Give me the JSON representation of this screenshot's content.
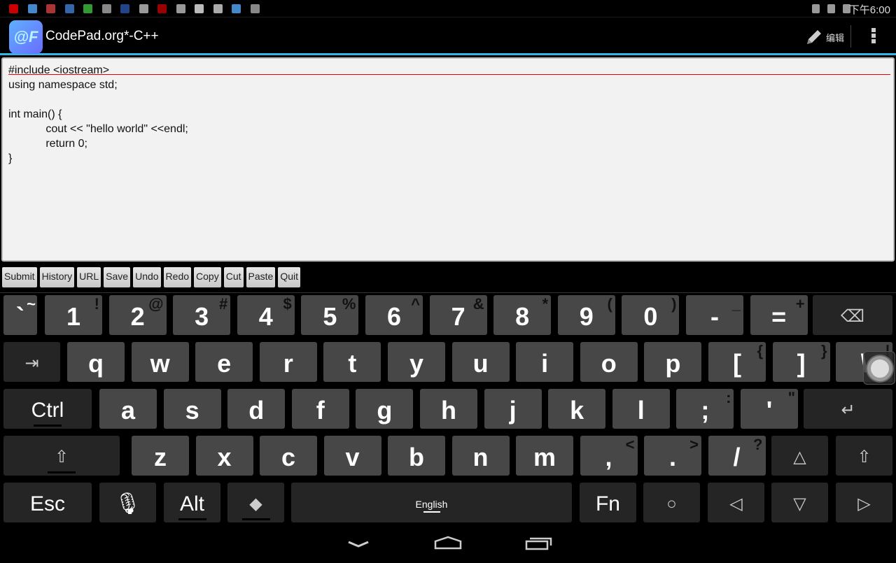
{
  "status_bar": {
    "time": "下午6:00",
    "notification_icons": [
      "play-icon",
      "butterfly-icon",
      "calendar-icon",
      "bird-icon",
      "network-icon",
      "circle-icon",
      "app-icon",
      "shield-icon",
      "badge-19-icon",
      "shield-icon",
      "keyboard-icon",
      "usb-icon",
      "butterfly-icon",
      "barcode-icon"
    ],
    "badge_number": "19",
    "system_icons": [
      "bluetooth-icon",
      "wifi-icon",
      "battery-charging-icon"
    ]
  },
  "action_bar": {
    "title": "CodePad.org*-C++",
    "logo_text": "@F",
    "edit_label": "编辑"
  },
  "editor": {
    "lines": [
      "#include <iostream>",
      "using namespace std;",
      "",
      "int main() {",
      "            cout << \"hello world\" <<endl;",
      "            return 0;",
      "}"
    ]
  },
  "toolbar": [
    "Submit",
    "History",
    "URL",
    "Save",
    "Undo",
    "Redo",
    "Copy",
    "Cut",
    "Paste",
    "Quit"
  ],
  "keyboard": {
    "rows": [
      [
        {
          "m": "`",
          "a": "~",
          "t": "l"
        },
        {
          "m": "1",
          "a": "!"
        },
        {
          "m": "2",
          "a": "@"
        },
        {
          "m": "3",
          "a": "#"
        },
        {
          "m": "4",
          "a": "$"
        },
        {
          "m": "5",
          "a": "%"
        },
        {
          "m": "6",
          "a": "^"
        },
        {
          "m": "7",
          "a": "&"
        },
        {
          "m": "8",
          "a": "*"
        },
        {
          "m": "9",
          "a": "("
        },
        {
          "m": "0",
          "a": ")"
        },
        {
          "m": "-",
          "a": "_"
        },
        {
          "m": "=",
          "a": "+"
        },
        {
          "m": "⌫",
          "t": "f",
          "n": "backspace"
        }
      ],
      [
        {
          "m": "⇥",
          "t": "f",
          "n": "tab"
        },
        {
          "m": "q"
        },
        {
          "m": "w"
        },
        {
          "m": "e"
        },
        {
          "m": "r"
        },
        {
          "m": "t"
        },
        {
          "m": "y"
        },
        {
          "m": "u"
        },
        {
          "m": "i"
        },
        {
          "m": "o"
        },
        {
          "m": "p"
        },
        {
          "m": "[",
          "a": "{"
        },
        {
          "m": "]",
          "a": "}"
        },
        {
          "m": "\\",
          "a": "|"
        }
      ],
      [
        {
          "m": "Ctrl",
          "t": "f",
          "u": true
        },
        {
          "m": "a"
        },
        {
          "m": "s"
        },
        {
          "m": "d"
        },
        {
          "m": "f"
        },
        {
          "m": "g"
        },
        {
          "m": "h"
        },
        {
          "m": "j"
        },
        {
          "m": "k"
        },
        {
          "m": "l"
        },
        {
          "m": ";",
          "a": ":"
        },
        {
          "m": "'",
          "a": "\""
        },
        {
          "m": "↵",
          "t": "f",
          "n": "enter"
        }
      ],
      [
        {
          "m": "⇧",
          "t": "f",
          "n": "shift",
          "u": true
        },
        {
          "m": "z"
        },
        {
          "m": "x"
        },
        {
          "m": "c"
        },
        {
          "m": "v"
        },
        {
          "m": "b"
        },
        {
          "m": "n"
        },
        {
          "m": "m"
        },
        {
          "m": ",",
          "a": "<"
        },
        {
          "m": ".",
          "a": ">"
        },
        {
          "m": "/",
          "a": "?"
        },
        {
          "m": "△",
          "t": "f",
          "n": "up-arrow"
        },
        {
          "m": "⇧",
          "t": "f",
          "n": "shift-right"
        }
      ],
      [
        {
          "m": "Esc",
          "t": "f"
        },
        {
          "m": "🎙",
          "t": "f",
          "n": "microphone"
        },
        {
          "m": "Alt",
          "t": "f",
          "u": true
        },
        {
          "m": "◆",
          "t": "f",
          "n": "meta",
          "u": true
        },
        {
          "m": "English",
          "t": "f",
          "n": "space"
        },
        {
          "m": "Fn",
          "t": "f"
        },
        {
          "m": "○",
          "t": "f",
          "n": "home-circle"
        },
        {
          "m": "◁",
          "t": "f",
          "n": "left-arrow"
        },
        {
          "m": "▽",
          "t": "f",
          "n": "down-arrow"
        },
        {
          "m": "▷",
          "t": "f",
          "n": "right-arrow"
        }
      ]
    ]
  },
  "nav_bar": [
    "back-icon",
    "home-icon",
    "recents-icon"
  ]
}
